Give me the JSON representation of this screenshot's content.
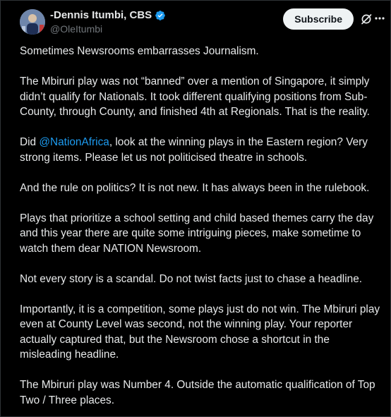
{
  "author": {
    "display_name": "-Dennis Itumbi, CBS",
    "handle": "@OleItumbi",
    "verified_color": "#1d9bf0"
  },
  "actions": {
    "subscribe_label": "Subscribe"
  },
  "icons": {
    "verified": "verified-badge-icon",
    "grok": "grok-icon",
    "more": "more-options-icon"
  },
  "colors": {
    "background": "#000000",
    "text": "#e7e9ea",
    "secondary_text": "#71767b",
    "link": "#1d9bf0",
    "button_bg": "#eff3f4"
  },
  "post": {
    "p1": "Sometimes Newsrooms embarrasses Journalism.",
    "p2": "The Mbiruri play was not “banned” over a mention of Singapore, it simply didn’t qualify for Nationals. It took different qualifying positions from Sub-County, through County, and finished 4th at Regionals. That is the reality.",
    "p3_before": "Did ",
    "p3_mention": "@NationAfrica",
    "p3_after": ", look at the winning plays in the Eastern region? Very strong items. Please let us not politicised theatre in schools.",
    "p4": "And the rule on politics? It is not new. It has always been in the rulebook.",
    "p5": "Plays that prioritize a school setting and child based themes carry the day and this year there are quite some intriguing pieces, make sometime to watch them dear NATION Newsroom.",
    "p6": "Not every story is a scandal. Do not twist facts just to chase a headline.",
    "p7": "Importantly, it is a competition, some plays just do not win. The Mbiruri play even at County Level was second, not the winning play. Your reporter actually captured that, but the Newsroom chose a shortcut in the misleading headline.",
    "p8": "The Mbiruri play was Number 4. Outside the automatic qualification of Top Two / Three places."
  }
}
